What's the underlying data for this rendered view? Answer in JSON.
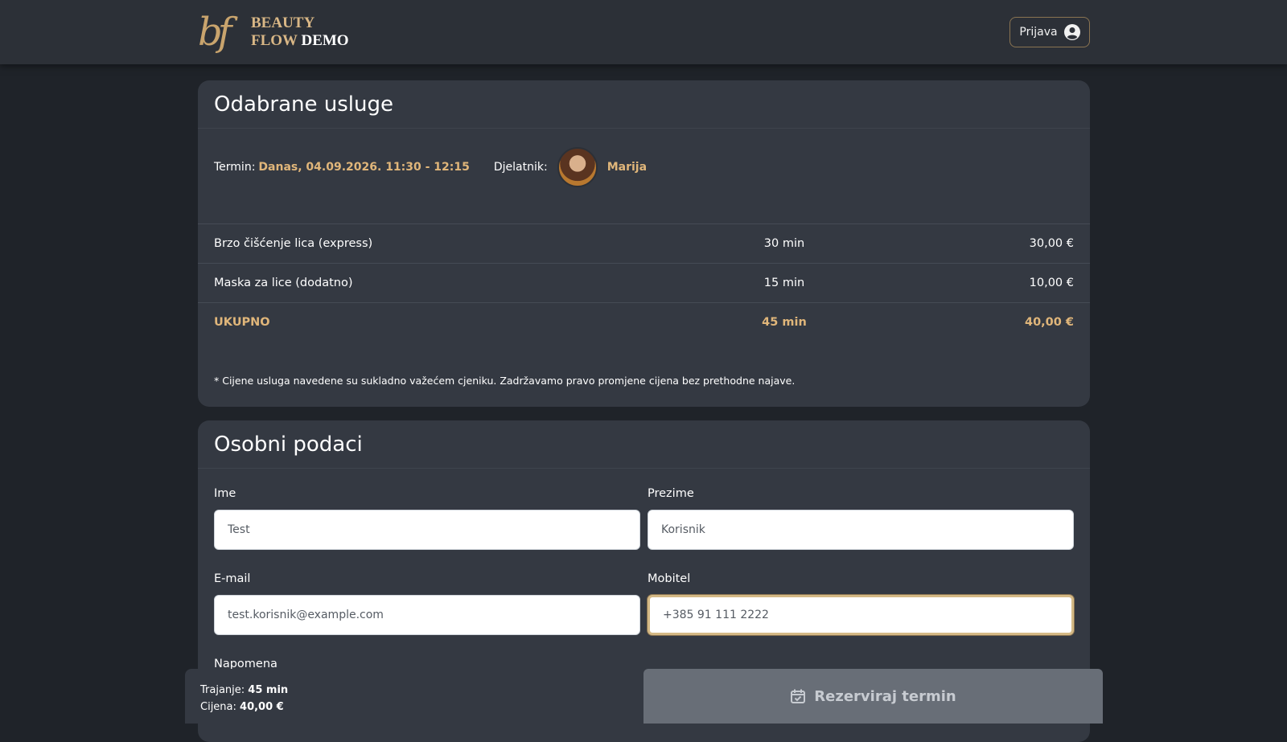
{
  "header": {
    "logo_mark": "bf",
    "logo_line1": "BEAUTY",
    "logo_line2a": "FLOW",
    "logo_line2b": "DEMO",
    "login_label": "Prijava",
    "login_icon": "user-circle-icon"
  },
  "services_card": {
    "title": "Odabrane usluge",
    "term_label": "Termin:",
    "term_value": "Danas, 04.09.2026. 11:30 - 12:15",
    "worker_label": "Djelatnik:",
    "worker_name": "Marija",
    "rows": [
      {
        "name": "Brzo čišćenje lica (express)",
        "duration": "30 min",
        "price": "30,00 €"
      },
      {
        "name": "Maska za lice (dodatno)",
        "duration": "15 min",
        "price": "10,00 €"
      }
    ],
    "total": {
      "name": "UKUPNO",
      "duration": "45 min",
      "price": "40,00 €"
    },
    "note": "* Cijene usluga navedene su sukladno važećem cjeniku. Zadržavamo pravo promjene cijena bez prethodne najave."
  },
  "personal_card": {
    "title": "Osobni podaci",
    "first_name_label": "Ime",
    "first_name_value": "Test",
    "last_name_label": "Prezime",
    "last_name_value": "Korisnik",
    "email_label": "E-mail",
    "email_value": "test.korisnik@example.com",
    "phone_label": "Mobitel",
    "phone_value": "+385 91 111 2222",
    "note_label": "Napomena"
  },
  "bottom_bar": {
    "duration_label": "Trajanje:",
    "duration_value": "45 min",
    "price_label": "Cijena:",
    "price_value": "40,00 €",
    "reserve_label": "Rezerviraj termin",
    "reserve_icon": "calendar-check-icon"
  },
  "colors": {
    "accent": "#e0b67a",
    "background": "#1f2329",
    "card": "#343942",
    "topbar": "#2c3037"
  }
}
